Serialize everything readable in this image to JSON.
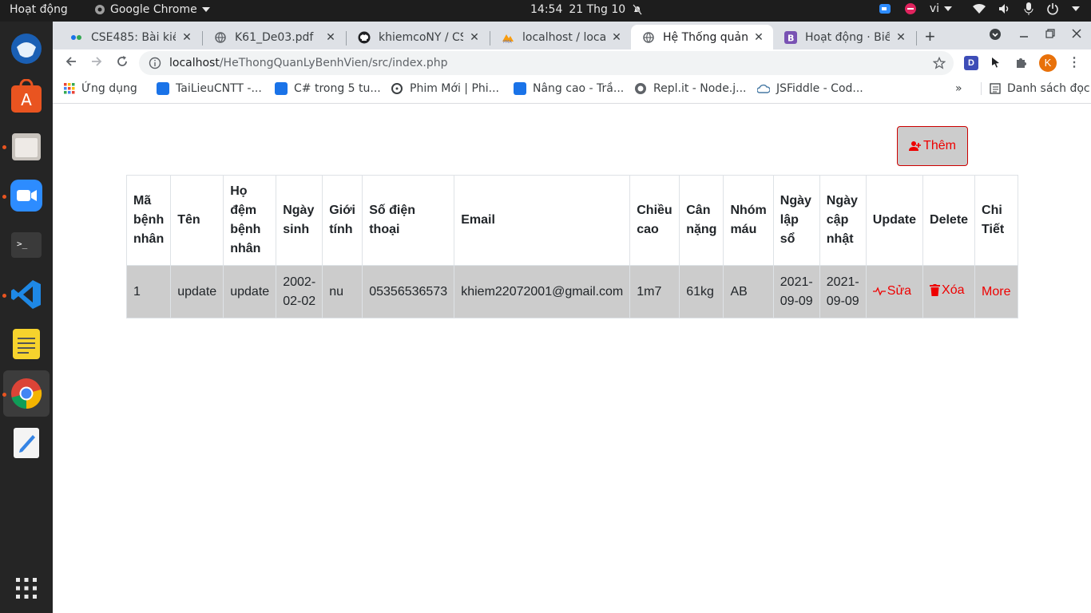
{
  "system_bar": {
    "activities": "Hoạt động",
    "app_name": "Google Chrome",
    "time": "14:54",
    "date": "21 Thg 10",
    "language": "vi"
  },
  "browser": {
    "tabs": [
      {
        "title": "CSE485: Bài kiểm",
        "icon": "teams-icon"
      },
      {
        "title": "K61_De03.pdf",
        "icon": "globe-icon"
      },
      {
        "title": "khiemcoNY / CSE",
        "icon": "github-icon"
      },
      {
        "title": "localhost / localh",
        "icon": "phpmyadmin-icon"
      },
      {
        "title": "Hệ Thống quản",
        "icon": "globe-icon",
        "active": true
      },
      {
        "title": "Hoạt động · Biể",
        "icon": "bootstrap-icon"
      }
    ],
    "url_host": "localhost",
    "url_path": "/HeThongQuanLyBenhVien/src/index.php",
    "profile_initial": "K",
    "bookmarks": [
      {
        "label": "Ứng dụng",
        "icon": "apps-grid-icon"
      },
      {
        "label": "TaiLieuCNTT -...",
        "icon": "tailieu-icon"
      },
      {
        "label": "C# trong 5 tu...",
        "icon": "tailieu-icon"
      },
      {
        "label": "Phim Mới | Phi...",
        "icon": "film-icon"
      },
      {
        "label": "Nâng cao - Trầ...",
        "icon": "tailieu-icon"
      },
      {
        "label": "Repl.it - Node.j...",
        "icon": "replit-icon"
      },
      {
        "label": "JSFiddle - Cod...",
        "icon": "jsfiddle-icon"
      }
    ],
    "overflow": "»",
    "reading_list": "Danh sách đọc"
  },
  "page": {
    "add_button": "Thêm",
    "table": {
      "headers": [
        "Mã bệnh nhân",
        "Tên",
        "Họ đệm bệnh nhân",
        "Ngày sinh",
        "Giới tính",
        "Số điện thoại",
        "Email",
        "Chiều cao",
        "Cân nặng",
        "Nhóm máu",
        "Ngày lập sổ",
        "Ngày cập nhật",
        "Update",
        "Delete",
        "Chi Tiết"
      ],
      "rows": [
        {
          "id": "1",
          "ten": "update",
          "ho_dem": "update",
          "ngay_sinh": "2002-02-02",
          "gioi_tinh": "nu",
          "sdt": "05356536573",
          "email": "khiem22072001@gmail.com",
          "chieu_cao": "1m7",
          "can_nang": "61kg",
          "nhom_mau": "AB",
          "ngay_lap": "2021-09-09",
          "ngay_cap_nhat": "2021-09-09",
          "update": "Sửa",
          "delete": "Xóa",
          "detail": "More"
        }
      ]
    }
  }
}
